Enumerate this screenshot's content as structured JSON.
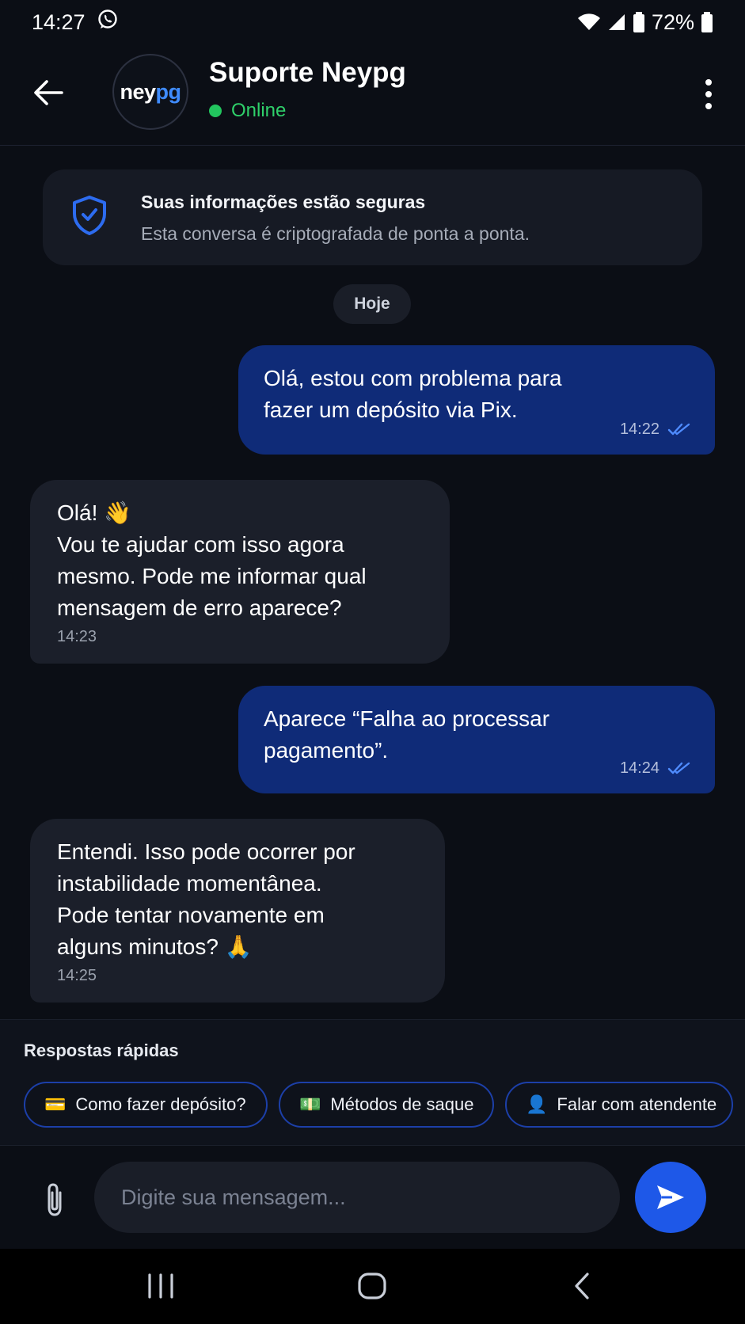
{
  "status_bar": {
    "time": "14:27",
    "notification_icon": "whatsapp-icon",
    "battery": "72%"
  },
  "header": {
    "avatar_text_a": "ney",
    "avatar_text_b": "pg",
    "name": "Suporte Neypg",
    "status": "Online",
    "status_color": "#22c55e"
  },
  "security": {
    "title": "Suas informações estão seguras",
    "text": "Esta conversa é criptografada de ponta a ponta."
  },
  "date_label": "Hoje",
  "messages": [
    {
      "direction": "out",
      "text": "Olá, estou com problema para\nfazer um depósito via Pix.",
      "time": "14:22",
      "read": true
    },
    {
      "direction": "in",
      "text": "Olá! 👋\nVou te ajudar com isso agora\nmesmo. Pode me informar qual\nmensagem de erro aparece?",
      "time": "14:23"
    },
    {
      "direction": "out",
      "text": "Aparece “Falha ao processar\npagamento”.",
      "time": "14:24",
      "read": true
    },
    {
      "direction": "in",
      "text": "Entendi. Isso pode ocorrer por\ninstabilidade momentânea.\nPode tentar novamente em\nalguns minutos? 🙏",
      "time": "14:25"
    }
  ],
  "quick_replies": {
    "title": "Respostas rápidas",
    "chips": [
      {
        "emoji": "💳",
        "label": "Como fazer depósito?"
      },
      {
        "emoji": "💵",
        "label": "Métodos de saque"
      },
      {
        "emoji": "👤",
        "label": "Falar com atendente"
      }
    ]
  },
  "composer": {
    "placeholder": "Digite sua mensagem...",
    "value": ""
  },
  "colors": {
    "accent": "#1e58e8",
    "outgoing_bubble": "#0f2b78",
    "incoming_bubble": "#1b1f2a",
    "background": "#0b0e15"
  }
}
